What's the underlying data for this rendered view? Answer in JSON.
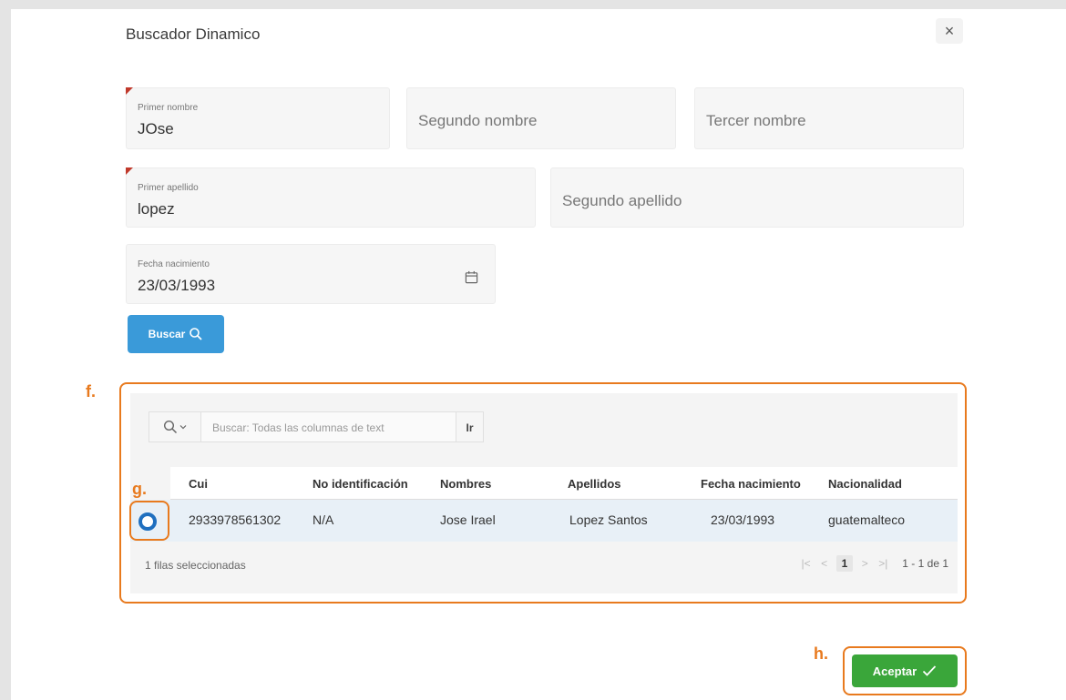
{
  "dialog": {
    "title": "Buscador Dinamico",
    "close_label": "×"
  },
  "form": {
    "primer_nombre": {
      "label": "Primer nombre",
      "value": "JOse"
    },
    "segundo_nombre": {
      "placeholder": "Segundo nombre"
    },
    "tercer_nombre": {
      "placeholder": "Tercer nombre"
    },
    "primer_apellido": {
      "label": "Primer apellido",
      "value": "lopez"
    },
    "segundo_apellido": {
      "placeholder": "Segundo apellido"
    },
    "fecha_nacimiento": {
      "label": "Fecha nacimiento",
      "value": "23/03/1993"
    },
    "buscar_label": "Buscar"
  },
  "grid": {
    "search_placeholder": "Buscar: Todas las columnas de text",
    "go_label": "Ir",
    "columns": [
      "Cui",
      "No identificación",
      "Nombres",
      "Apellidos",
      "Fecha nacimiento",
      "Nacionalidad"
    ],
    "rows": [
      {
        "cui": "2933978561302",
        "no_id": "N/A",
        "nombres": "Jose Irael",
        "apellidos": "Lopez Santos",
        "fecha": "23/03/1993",
        "nacionalidad": "guatemalteco"
      }
    ],
    "selected_text": "1 filas seleccionadas",
    "pagination": {
      "current": "1",
      "range": "1 - 1 de 1"
    }
  },
  "markers": {
    "f": "f.",
    "g": "g.",
    "h": "h."
  },
  "actions": {
    "accept_label": "Aceptar"
  },
  "colors": {
    "accent_orange": "#e87a1e",
    "buscar_blue": "#3a9ad9",
    "accept_green": "#3aa63a",
    "radio_blue": "#1f6fbf"
  }
}
